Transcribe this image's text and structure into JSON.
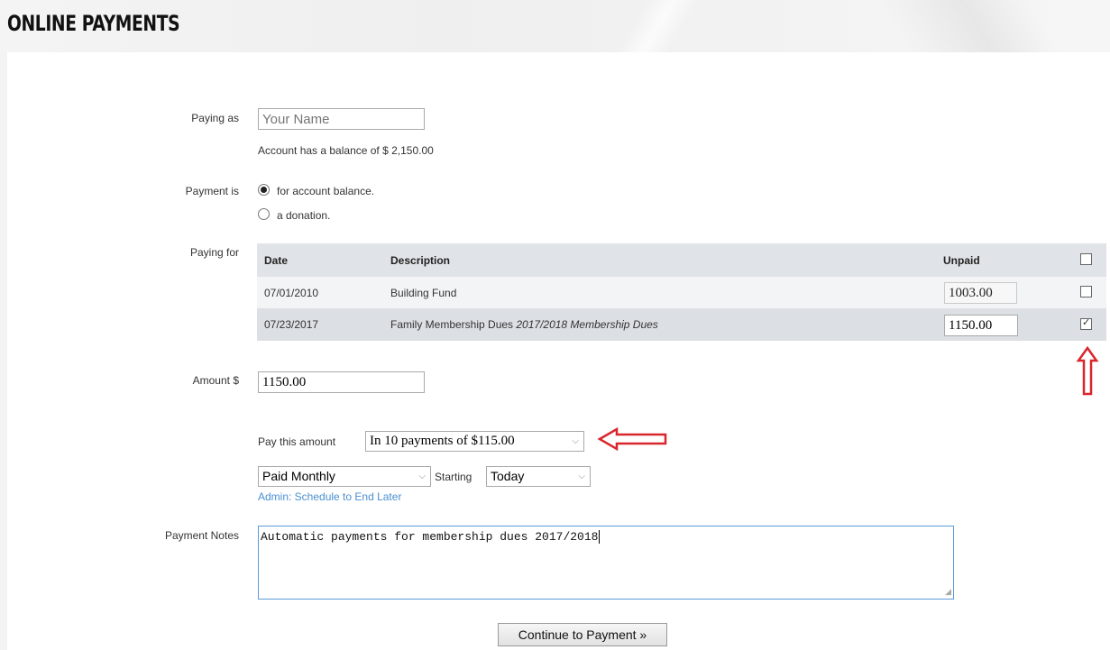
{
  "page": {
    "title": "ONLINE PAYMENTS"
  },
  "form": {
    "paying_as": {
      "label": "Paying as",
      "placeholder": "Your Name",
      "value": ""
    },
    "balance_text": "Account has a balance of $ 2,150.00",
    "payment_is": {
      "label": "Payment is",
      "options": [
        {
          "label": "for account balance.",
          "checked": true
        },
        {
          "label": "a donation.",
          "checked": false
        }
      ]
    },
    "paying_for": {
      "label": "Paying for",
      "columns": [
        "Date",
        "Description",
        "Unpaid"
      ],
      "select_all_checked": false,
      "rows": [
        {
          "date": "07/01/2010",
          "description": "Building Fund",
          "description_italic": "",
          "unpaid": "1003.00",
          "checked": false
        },
        {
          "date": "07/23/2017",
          "description": "Family Membership Dues ",
          "description_italic": "2017/2018 Membership Dues",
          "unpaid": "1150.00",
          "checked": true
        }
      ]
    },
    "amount": {
      "label": "Amount $",
      "value": "1150.00"
    },
    "pay_this_amount": {
      "label": "Pay this amount",
      "selected": "In 10 payments of $115.00"
    },
    "frequency": {
      "selected": "Paid Monthly"
    },
    "starting": {
      "label": "Starting",
      "selected": "Today"
    },
    "admin_link": "Admin: Schedule to End Later",
    "payment_notes": {
      "label": "Payment Notes",
      "value": "Automatic payments for membership dues 2017/2018"
    },
    "continue_button": "Continue to Payment »"
  },
  "annotations": {
    "arrow_color": "#d9262c"
  },
  "colors": {
    "link": "#4a8fd1",
    "table_header": "#e0e3e7",
    "row_highlight": "#dcdfe3"
  }
}
